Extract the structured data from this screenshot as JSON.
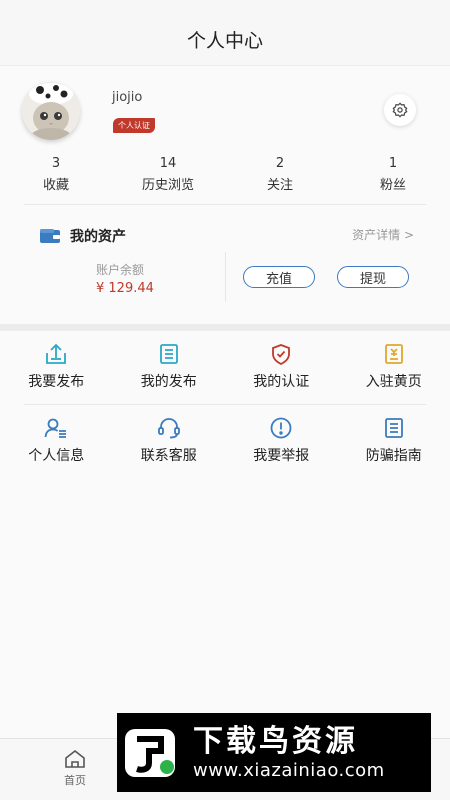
{
  "header": {
    "title": "个人中心"
  },
  "profile": {
    "username": "jiojio",
    "badge": "个人认证",
    "stats": [
      {
        "value": "3",
        "label": "收藏"
      },
      {
        "value": "14",
        "label": "历史浏览"
      },
      {
        "value": "2",
        "label": "关注"
      },
      {
        "value": "1",
        "label": "粉丝"
      }
    ]
  },
  "assets": {
    "title": "我的资产",
    "detail_link": "资产详情 >",
    "balance_label": "账户余额",
    "balance_value": "¥ 129.44",
    "recharge_label": "充值",
    "withdraw_label": "提现"
  },
  "menu": {
    "row1": [
      {
        "label": "我要发布",
        "icon": "upload-icon"
      },
      {
        "label": "我的发布",
        "icon": "document-list-icon"
      },
      {
        "label": "我的认证",
        "icon": "shield-check-icon"
      },
      {
        "label": "入驻黄页",
        "icon": "yellow-pages-icon"
      }
    ],
    "row2": [
      {
        "label": "个人信息",
        "icon": "user-info-icon"
      },
      {
        "label": "联系客服",
        "icon": "headset-icon"
      },
      {
        "label": "我要举报",
        "icon": "alert-circle-icon"
      },
      {
        "label": "防骗指南",
        "icon": "guide-icon"
      }
    ]
  },
  "bottom_nav": {
    "home_label": "首页"
  },
  "watermark": {
    "brand": "下载鸟资源",
    "url": "www.xiazainiao.com"
  },
  "colors": {
    "accent_red": "#c0392b",
    "accent_blue": "#3b7bbf",
    "icon_cyan": "#2aa8c8",
    "icon_gold": "#e0a82e"
  }
}
